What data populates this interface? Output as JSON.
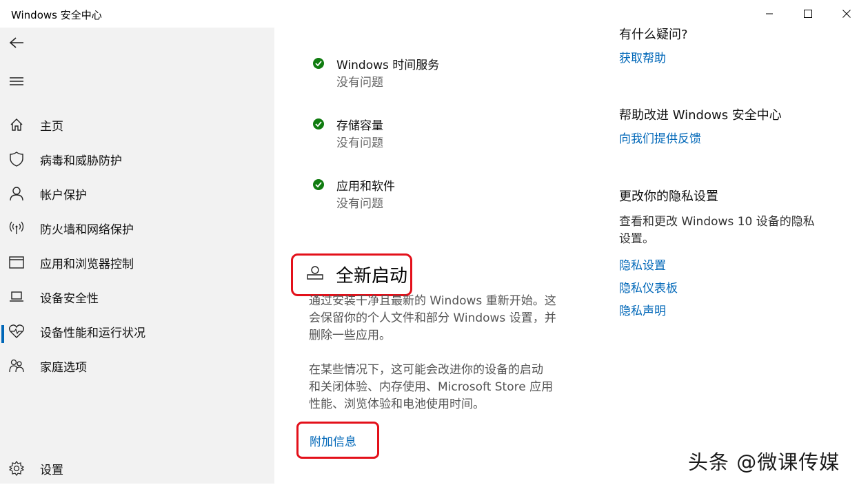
{
  "window": {
    "title": "Windows 安全中心",
    "minimize_icon": "minimize-icon",
    "maximize_icon": "maximize-icon",
    "close_icon": "close-icon"
  },
  "sidebar": {
    "back_icon": "back-arrow-icon",
    "menu_icon": "hamburger-icon",
    "items": [
      {
        "label": "主页",
        "icon": "home-icon"
      },
      {
        "label": "病毒和威胁防护",
        "icon": "shield-icon"
      },
      {
        "label": "帐户保护",
        "icon": "person-icon"
      },
      {
        "label": "防火墙和网络保护",
        "icon": "wifi-antenna-icon"
      },
      {
        "label": "应用和浏览器控制",
        "icon": "browser-window-icon"
      },
      {
        "label": "设备安全性",
        "icon": "laptop-icon"
      },
      {
        "label": "设备性能和运行状况",
        "icon": "heart-pulse-icon",
        "active": true
      },
      {
        "label": "家庭选项",
        "icon": "family-icon"
      }
    ],
    "settings": {
      "label": "设置",
      "icon": "gear-icon"
    }
  },
  "main": {
    "status_items": [
      {
        "title": "Windows 时间服务",
        "status": "没有问题"
      },
      {
        "title": "存储容量",
        "status": "没有问题"
      },
      {
        "title": "应用和软件",
        "status": "没有问题"
      }
    ],
    "fresh_start": {
      "title": "全新启动",
      "icon": "fresh-start-icon",
      "para1_line1": "通过安装干净且最新的 Windows 重新开始。这",
      "para1_line2": "会保留你的个人文件和部分 Windows 设置，并",
      "para1_line3": "删除一些应用。",
      "para2_line1": "在某些情况下，这可能会改进你的设备的启动",
      "para2_line2": "和关闭体验、内存使用、Microsoft Store 应用",
      "para2_line3": "性能、浏览体验和电池使用时间。",
      "link": "附加信息"
    }
  },
  "right": {
    "question_heading": "有什么疑问?",
    "help_link": "获取帮助",
    "improve_heading": "帮助改进 Windows 安全中心",
    "feedback_link": "向我们提供反馈",
    "privacy_heading": "更改你的隐私设置",
    "privacy_text_line1": "查看和更改 Windows 10 设备的隐私",
    "privacy_text_line2": "设置。",
    "privacy_links": [
      "隐私设置",
      "隐私仪表板",
      "隐私声明"
    ]
  },
  "watermark": "头条 @微课传媒",
  "colors": {
    "accent": "#0067b8",
    "ok_green": "#107c10",
    "highlight_red": "#e3101a",
    "sidebar_bg": "#f2f2f2"
  }
}
